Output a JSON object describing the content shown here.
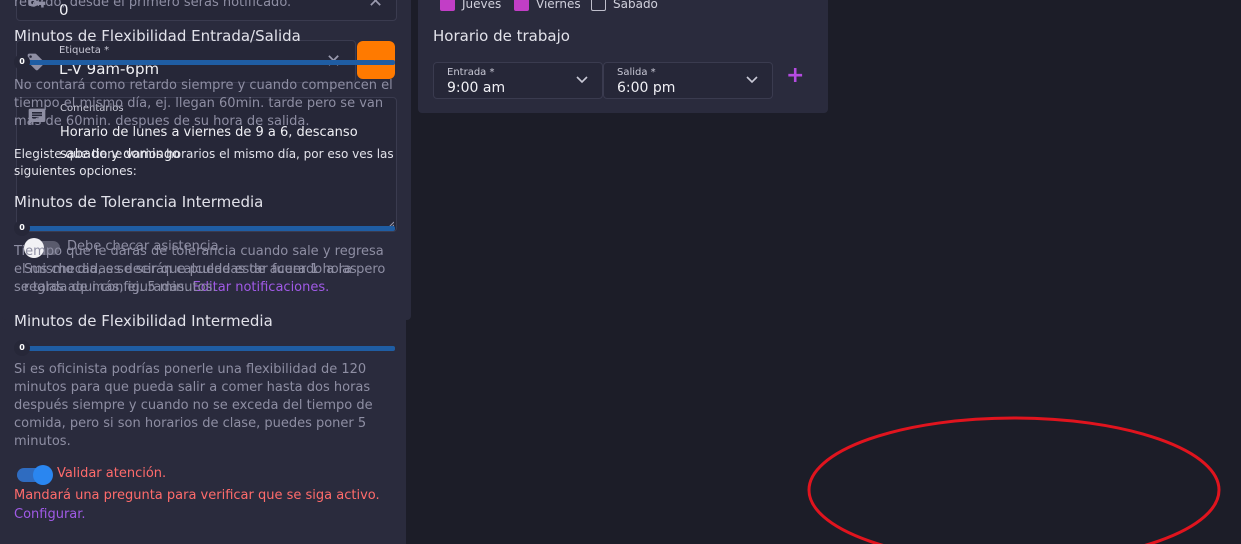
{
  "left": {
    "key_field": {
      "value": "0"
    },
    "label_field": {
      "label": "Etiqueta *",
      "value": "L-V 9am-6pm",
      "color": "#ff7a00"
    },
    "comments": {
      "label": "Comentarios",
      "value": "Horario de lunes a viernes de 9 a 6, descanso sabado y domingo"
    },
    "attendance_toggle": {
      "label": "Debe checar asistencia."
    },
    "help_text": "Sus checadas se serán calculadas de acuerdo a las reglas aqui configuradas.",
    "help_link": "Editar notificaciones."
  },
  "middle": {
    "days": [
      {
        "label": "Jueves",
        "checked": true
      },
      {
        "label": "Viernes",
        "checked": true
      },
      {
        "label": "Sábado",
        "checked": false
      }
    ],
    "schedule_title": "Horario de trabajo",
    "entrada": {
      "label": "Entrada *",
      "value": "9:00 am"
    },
    "salida": {
      "label": "Salida *",
      "value": "6:00 pm"
    },
    "add_symbol": "+"
  },
  "right": {
    "top_text": "retardo, desde el primero serás notificado.",
    "flex_io": {
      "title": "Minutos de Flexibilidad Entrada/Salida",
      "slider_value": "0",
      "desc": "No contará como retardo siempre y cuando compencen el tiempo el mismo día, ej. llegan 60min. tarde pero se van más de 60min. despues de su hora de salida."
    },
    "notice": "Elegiste que tiene varios horarios el mismo día, por eso ves las siguientes opciones:",
    "tol_mid": {
      "title": "Minutos de Tolerancia Intermedia",
      "slider_value": "0",
      "desc": "Tiempo que le darás de tolerancia cuando sale y regresa el mismo dia, es decir que puede estar fuera 1 hora pero se tarda de más, ej. 5 minutos."
    },
    "flex_mid": {
      "title": "Minutos de Flexibilidad Intermedia",
      "slider_value": "0",
      "desc": "Si es oficinista podrías ponerle una flexibilidad de 120 minutos para que pueda salir a comer hasta dos horas después siempre y cuando no se exceda del tiempo de comida, pero si son horarios de clase, puedes poner 5 minutos."
    },
    "validate_toggle": {
      "label": "Validar atención."
    },
    "validate_warning": "Mandará una pregunta para verificar que se siga activo.",
    "config_link": "Configurar.",
    "accent_red": "#ff6b6b"
  }
}
